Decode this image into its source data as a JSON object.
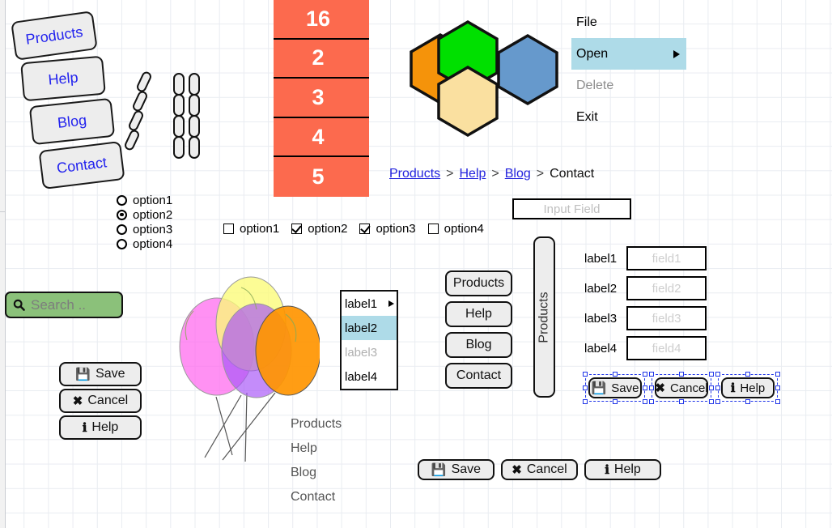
{
  "nav_rotated": [
    {
      "label": "Products"
    },
    {
      "label": "Help"
    },
    {
      "label": "Blog"
    },
    {
      "label": "Contact"
    }
  ],
  "table": {
    "rows": [
      "16",
      "2",
      "3",
      "4",
      "5"
    ],
    "fill_color": "#fc6a4e",
    "text_color": "#ffffff"
  },
  "hexagons": [
    {
      "name": "orange",
      "color": "#f5930a"
    },
    {
      "name": "green",
      "color": "#00e000"
    },
    {
      "name": "tan",
      "color": "#fae0a0"
    },
    {
      "name": "blue",
      "color": "#6699cc"
    }
  ],
  "menu": {
    "items": [
      {
        "label": "File",
        "state": "normal"
      },
      {
        "label": "Open",
        "state": "selected",
        "has_submenu": true
      },
      {
        "label": "Delete",
        "state": "disabled"
      },
      {
        "label": "Exit",
        "state": "normal"
      }
    ],
    "highlight_color": "#aedbe8"
  },
  "breadcrumb": {
    "links": [
      "Products",
      "Help",
      "Blog"
    ],
    "current": "Contact",
    "separator": ">"
  },
  "input_field": {
    "placeholder": "Input Field"
  },
  "radios": {
    "items": [
      {
        "label": "option1",
        "checked": false
      },
      {
        "label": "option2",
        "checked": true
      },
      {
        "label": "option3",
        "checked": false
      },
      {
        "label": "option4",
        "checked": false
      }
    ]
  },
  "checkboxes": {
    "items": [
      {
        "label": "option1",
        "checked": false
      },
      {
        "label": "option2",
        "checked": true
      },
      {
        "label": "option3",
        "checked": true
      },
      {
        "label": "option4",
        "checked": false
      }
    ]
  },
  "search": {
    "placeholder": "Search ..",
    "icon": "search-icon",
    "fill_color": "#8bc17a"
  },
  "buttons_left": [
    {
      "label": "Save",
      "icon": "floppy-disk-icon",
      "glyph": "💾"
    },
    {
      "label": "Cancel",
      "icon": "close-x-icon",
      "glyph": "✖"
    },
    {
      "label": "Help",
      "icon": "info-icon",
      "glyph": "ℹ"
    }
  ],
  "listbox": {
    "items": [
      {
        "label": "label1",
        "state": "normal",
        "has_arrow": true
      },
      {
        "label": "label2",
        "state": "selected"
      },
      {
        "label": "label3",
        "state": "disabled"
      },
      {
        "label": "label4",
        "state": "normal"
      }
    ]
  },
  "vnav": [
    {
      "label": "Products"
    },
    {
      "label": "Help"
    },
    {
      "label": "Blog"
    },
    {
      "label": "Contact"
    }
  ],
  "vertical_tab": {
    "label": "Products"
  },
  "form": {
    "rows": [
      {
        "label": "label1",
        "placeholder": "field1"
      },
      {
        "label": "label2",
        "placeholder": "field2"
      },
      {
        "label": "label3",
        "placeholder": "field3"
      },
      {
        "label": "label4",
        "placeholder": "field4"
      }
    ]
  },
  "selected_buttons": {
    "selection_color": "#1e34e8",
    "items": [
      {
        "label": "Save",
        "icon": "floppy-disk-icon",
        "glyph": "💾"
      },
      {
        "label": "Cancel",
        "icon": "close-x-icon",
        "glyph": "✖"
      },
      {
        "label": "Help",
        "icon": "info-icon",
        "glyph": "ℹ"
      }
    ]
  },
  "text_nav": [
    {
      "label": "Products"
    },
    {
      "label": "Help"
    },
    {
      "label": "Blog"
    },
    {
      "label": "Contact"
    }
  ],
  "buttons_bottom": [
    {
      "label": "Save",
      "icon": "floppy-disk-icon",
      "glyph": "💾"
    },
    {
      "label": "Cancel",
      "icon": "close-x-icon",
      "glyph": "✖"
    },
    {
      "label": "Help",
      "icon": "info-icon",
      "glyph": "ℹ"
    }
  ],
  "balloons": [
    {
      "color": "#ff66ee"
    },
    {
      "color": "#fbfb77"
    },
    {
      "color": "#a855f7"
    },
    {
      "color": "#ff9500"
    }
  ]
}
